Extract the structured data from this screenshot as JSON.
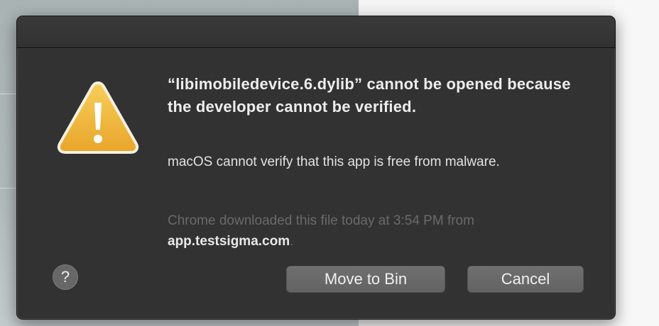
{
  "dialog": {
    "title": "“libimobiledevice.6.dylib” cannot be opened because the developer cannot be verified.",
    "message": "macOS cannot verify that this app is free from malware.",
    "source_prefix": "Chrome downloaded this file today at 3:54 PM from",
    "source_host": "app.testsigma.com",
    "source_suffix": ".",
    "icon": "warning-icon",
    "help_label": "?",
    "buttons": {
      "move_to_bin": "Move to Bin",
      "cancel": "Cancel"
    }
  },
  "colors": {
    "dialog_bg": "#323232",
    "warning_fill": "#f0b43a",
    "button_bg": "#6a6a6a"
  }
}
